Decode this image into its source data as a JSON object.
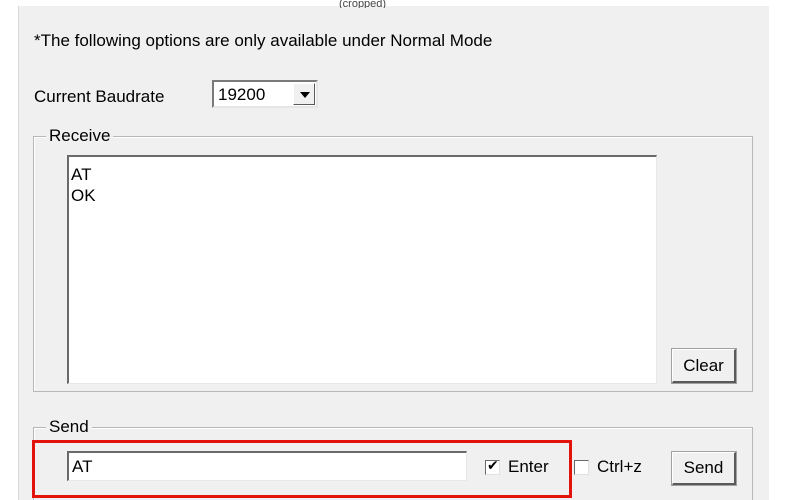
{
  "note": "*The following options are only available under Normal Mode",
  "baudrate": {
    "label": "Current Baudrate",
    "value": "19200",
    "dropdown_icon": "chevron-down-icon"
  },
  "receive": {
    "group_label": "Receive",
    "text": "AT\nOK",
    "clear_label": "Clear"
  },
  "send": {
    "group_label": "Send",
    "input_value": "AT",
    "enter_label": "Enter",
    "enter_checked": true,
    "ctrlz_label": "Ctrl+z",
    "ctrlz_checked": false,
    "send_label": "Send"
  },
  "colors": {
    "panel_background": "#f0f0f0",
    "highlight": "#e3120b"
  }
}
